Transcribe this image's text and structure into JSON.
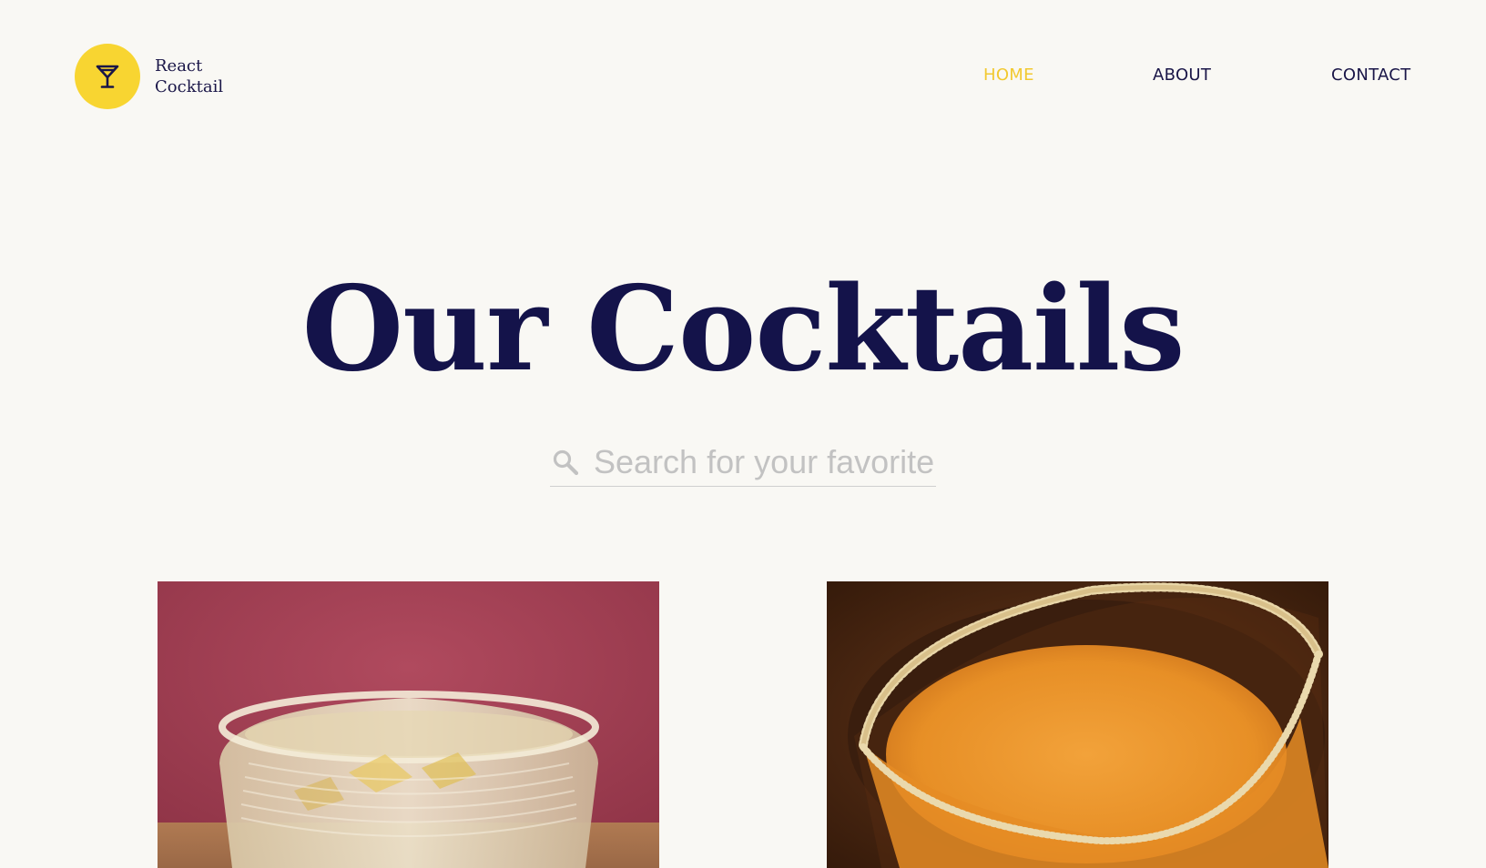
{
  "brand": {
    "line1": "React",
    "line2": "Cocktail",
    "icon": "cocktail-glass-icon",
    "accent_color": "#f8d531"
  },
  "nav": {
    "items": [
      {
        "label": "HOME",
        "active": true
      },
      {
        "label": "ABOUT",
        "active": false
      },
      {
        "label": "CONTACT",
        "active": false
      }
    ],
    "active_color": "#f2c930",
    "text_color": "#1a1648"
  },
  "hero": {
    "title": "Our Cocktails"
  },
  "search": {
    "placeholder": "Search for your favorite",
    "value": "",
    "icon": "search-icon"
  },
  "cards": [
    {
      "image": "cocktail-rocks-glass-photo"
    },
    {
      "image": "cocktail-martini-glass-photo"
    }
  ]
}
